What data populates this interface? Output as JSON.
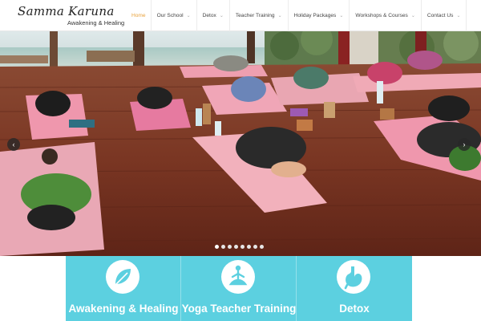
{
  "brand": {
    "name": "Samma Karuna",
    "tagline": "Awakening & Healing"
  },
  "nav": {
    "items": [
      {
        "label": "Home",
        "active": true,
        "has_dropdown": false
      },
      {
        "label": "Our School",
        "active": false,
        "has_dropdown": true
      },
      {
        "label": "Detox",
        "active": false,
        "has_dropdown": true
      },
      {
        "label": "Teacher Training",
        "active": false,
        "has_dropdown": true
      },
      {
        "label": "Holiday Packages",
        "active": false,
        "has_dropdown": true
      },
      {
        "label": "Workshops & Courses",
        "active": false,
        "has_dropdown": true
      },
      {
        "label": "Contact Us",
        "active": false,
        "has_dropdown": true
      }
    ],
    "caret_icon": "chevron-down-icon",
    "active_color": "#e8a33d"
  },
  "slider": {
    "prev_icon": "chevron-left-icon",
    "next_icon": "chevron-right-icon",
    "prev_glyph": "‹",
    "next_glyph": "›",
    "slide_count": 8,
    "active_slide": 1,
    "image_subject": "yoga class in child's pose on a wooden deck by the sea"
  },
  "features": {
    "accent_color": "#5cd0e0",
    "items": [
      {
        "title": "Awakening & Healing",
        "icon": "leaf-icon"
      },
      {
        "title": "Yoga Teacher Training",
        "icon": "meditation-icon"
      },
      {
        "title": "Detox",
        "icon": "stomach-icon"
      }
    ]
  }
}
